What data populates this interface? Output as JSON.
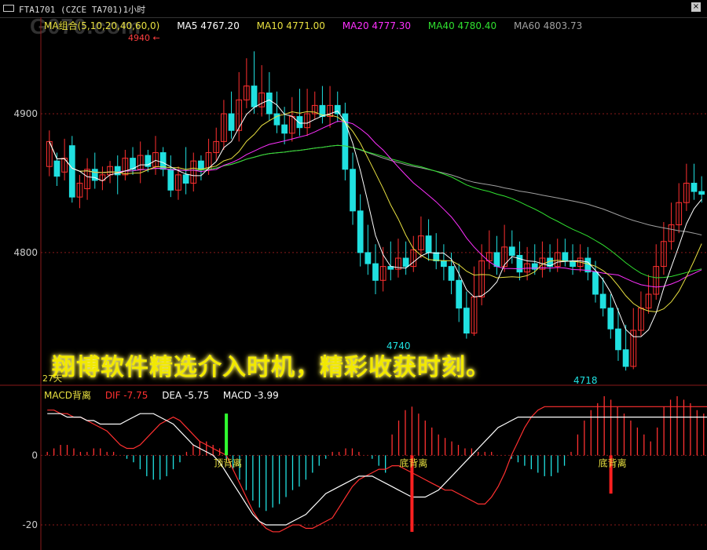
{
  "window": {
    "title": "FTA1701 (CZCE TA701)1小时",
    "close_glyph": "×"
  },
  "watermark": "G070.com",
  "ma_legend": [
    {
      "label": "MA组合(5,10,20,40,60,0)",
      "color": "#e8e040"
    },
    {
      "label": "MA5 4767.20",
      "color": "#ffffff"
    },
    {
      "label": "MA10 4771.00",
      "color": "#e8e040"
    },
    {
      "label": "MA20 4777.30",
      "color": "#ff30ff"
    },
    {
      "label": "MA40 4780.40",
      "color": "#30e030"
    },
    {
      "label": "MA60 4803.73",
      "color": "#a0a0a0"
    }
  ],
  "macd_legend": [
    {
      "label": "MACD背离",
      "color": "#e8e040"
    },
    {
      "label": "DIF  -7.75",
      "color": "#ff3030"
    },
    {
      "label": "DEA  -5.75",
      "color": "#ffffff"
    },
    {
      "label": "MACD  -3.99",
      "color": "#ffffff"
    }
  ],
  "banner": "翔博软件精选介入时机，精彩收获时刻。",
  "annotations": {
    "high_marker": "4940",
    "low1": "4740",
    "low2": "4718",
    "bottom_label": "27天"
  },
  "macd_annotations": [
    "顶背离",
    "底背离",
    "底背离"
  ],
  "colors": {
    "up": "#ff3030",
    "down": "#20e0e0",
    "grid": "#8a1a1a"
  },
  "chart_data": [
    {
      "type": "candlestick",
      "title": "",
      "y_ticks": [
        4800,
        4900
      ],
      "ylim": [
        4705,
        4965
      ],
      "candles": [
        [
          4862,
          4880,
          4866,
          4888,
          4855
        ],
        [
          4866,
          4855,
          4858,
          4872,
          4848
        ],
        [
          4858,
          4868,
          4877,
          4882,
          4852
        ],
        [
          4877,
          4840,
          4881,
          4884,
          4836
        ],
        [
          4840,
          4850,
          4846,
          4856,
          4832
        ],
        [
          4846,
          4860,
          4860,
          4868,
          4838
        ],
        [
          4860,
          4852,
          4866,
          4872,
          4846
        ],
        [
          4852,
          4856,
          4857,
          4862,
          4845
        ],
        [
          4856,
          4862,
          4856,
          4866,
          4850
        ],
        [
          4862,
          4856,
          4866,
          4870,
          4842
        ],
        [
          4856,
          4868,
          4870,
          4874,
          4852
        ],
        [
          4868,
          4860,
          4872,
          4876,
          4856
        ],
        [
          4860,
          4870,
          4872,
          4880,
          4850
        ],
        [
          4870,
          4862,
          4866,
          4874,
          4858
        ],
        [
          4862,
          4872,
          4880,
          4884,
          4856
        ],
        [
          4872,
          4860,
          4866,
          4876,
          4855
        ],
        [
          4860,
          4845,
          4866,
          4870,
          4840
        ],
        [
          4845,
          4856,
          4858,
          4862,
          4838
        ],
        [
          4856,
          4850,
          4872,
          4876,
          4842
        ],
        [
          4850,
          4866,
          4868,
          4872,
          4844
        ],
        [
          4866,
          4860,
          4868,
          4870,
          4852
        ],
        [
          4860,
          4872,
          4878,
          4882,
          4856
        ],
        [
          4872,
          4880,
          4884,
          4890,
          4866
        ],
        [
          4880,
          4900,
          4906,
          4910,
          4874
        ],
        [
          4900,
          4888,
          4910,
          4916,
          4882
        ],
        [
          4888,
          4910,
          4922,
          4930,
          4880
        ],
        [
          4910,
          4920,
          4925,
          4940,
          4904
        ],
        [
          4920,
          4905,
          4932,
          4945,
          4900
        ],
        [
          4905,
          4915,
          4925,
          4935,
          4898
        ],
        [
          4915,
          4900,
          4925,
          4930,
          4895
        ],
        [
          4900,
          4892,
          4910,
          4916,
          4886
        ],
        [
          4892,
          4886,
          4898,
          4905,
          4878
        ],
        [
          4886,
          4898,
          4905,
          4912,
          4880
        ],
        [
          4898,
          4890,
          4910,
          4918,
          4884
        ],
        [
          4890,
          4900,
          4910,
          4918,
          4884
        ],
        [
          4900,
          4906,
          4908,
          4916,
          4896
        ],
        [
          4906,
          4898,
          4914,
          4920,
          4893
        ],
        [
          4898,
          4906,
          4912,
          4920,
          4890
        ],
        [
          4906,
          4900,
          4912,
          4916,
          4894
        ],
        [
          4900,
          4860,
          4905,
          4908,
          4852
        ],
        [
          4860,
          4830,
          4866,
          4872,
          4820
        ],
        [
          4830,
          4800,
          4834,
          4842,
          4790
        ],
        [
          4800,
          4792,
          4812,
          4820,
          4784
        ],
        [
          4792,
          4780,
          4800,
          4806,
          4770
        ],
        [
          4780,
          4790,
          4797,
          4804,
          4772
        ],
        [
          4790,
          4788,
          4800,
          4808,
          4780
        ],
        [
          4788,
          4796,
          4802,
          4810,
          4782
        ],
        [
          4796,
          4790,
          4800,
          4808,
          4784
        ],
        [
          4790,
          4802,
          4806,
          4812,
          4786
        ],
        [
          4802,
          4812,
          4820,
          4826,
          4796
        ],
        [
          4812,
          4800,
          4818,
          4824,
          4794
        ],
        [
          4800,
          4794,
          4808,
          4814,
          4788
        ],
        [
          4794,
          4790,
          4800,
          4806,
          4780
        ],
        [
          4790,
          4780,
          4796,
          4800,
          4770
        ],
        [
          4780,
          4760,
          4788,
          4792,
          4750
        ],
        [
          4760,
          4742,
          4766,
          4772,
          4738
        ],
        [
          4742,
          4768,
          4776,
          4790,
          4740
        ],
        [
          4768,
          4794,
          4802,
          4806,
          4762
        ],
        [
          4794,
          4800,
          4808,
          4816,
          4788
        ],
        [
          4800,
          4790,
          4806,
          4812,
          4784
        ],
        [
          4790,
          4804,
          4812,
          4820,
          4786
        ],
        [
          4804,
          4798,
          4810,
          4816,
          4792
        ],
        [
          4798,
          4786,
          4802,
          4808,
          4780
        ],
        [
          4786,
          4792,
          4798,
          4804,
          4780
        ],
        [
          4792,
          4788,
          4800,
          4806,
          4784
        ],
        [
          4788,
          4796,
          4800,
          4808,
          4782
        ],
        [
          4796,
          4790,
          4800,
          4806,
          4786
        ],
        [
          4790,
          4800,
          4804,
          4810,
          4786
        ],
        [
          4800,
          4794,
          4806,
          4810,
          4790
        ],
        [
          4794,
          4790,
          4800,
          4806,
          4784
        ],
        [
          4790,
          4796,
          4800,
          4806,
          4786
        ],
        [
          4796,
          4786,
          4800,
          4804,
          4780
        ],
        [
          4786,
          4770,
          4790,
          4794,
          4764
        ],
        [
          4770,
          4760,
          4776,
          4782,
          4754
        ],
        [
          4760,
          4745,
          4765,
          4770,
          4738
        ],
        [
          4745,
          4730,
          4752,
          4760,
          4722
        ],
        [
          4730,
          4718,
          4740,
          4748,
          4715
        ],
        [
          4718,
          4744,
          4752,
          4760,
          4716
        ],
        [
          4744,
          4760,
          4766,
          4772,
          4740
        ],
        [
          4760,
          4770,
          4776,
          4784,
          4756
        ],
        [
          4770,
          4790,
          4796,
          4806,
          4766
        ],
        [
          4790,
          4808,
          4814,
          4822,
          4784
        ],
        [
          4808,
          4820,
          4826,
          4836,
          4802
        ],
        [
          4820,
          4836,
          4842,
          4850,
          4814
        ],
        [
          4836,
          4850,
          4856,
          4864,
          4830
        ],
        [
          4850,
          4844,
          4858,
          4864,
          4838
        ],
        [
          4844,
          4842,
          4848,
          4855,
          4836
        ]
      ]
    },
    {
      "type": "bar+line",
      "title": "",
      "y_ticks": [
        0,
        -20
      ],
      "ylim": [
        -27,
        17
      ],
      "macd": [
        1,
        2,
        3,
        3,
        2,
        1,
        1,
        2,
        2,
        1,
        1,
        0,
        -1,
        -2,
        -4,
        -6,
        -7,
        -7,
        -6,
        -4,
        -2,
        1,
        3,
        4,
        4,
        3,
        2,
        -1,
        -4,
        -7,
        -10,
        -13,
        -15,
        -16,
        -15,
        -14,
        -12,
        -10,
        -9,
        -7,
        -5,
        -3,
        -1,
        1,
        1,
        2,
        2,
        1,
        0,
        -1,
        -3,
        -5,
        6,
        10,
        13,
        14,
        12,
        10,
        8,
        6,
        5,
        4,
        3,
        2,
        2,
        1,
        1,
        1,
        0,
        0,
        -1,
        -2,
        -3,
        -4,
        -5,
        -6,
        -6,
        -5,
        -3,
        1,
        6,
        10,
        13,
        15,
        17,
        16,
        14,
        12,
        10,
        8,
        6,
        4,
        8,
        14,
        16,
        17,
        16,
        15,
        13,
        12
      ],
      "dif": [
        13,
        13,
        12,
        12,
        11,
        11,
        10,
        9,
        8,
        7,
        5,
        3,
        2,
        2,
        3,
        5,
        7,
        9,
        10,
        11,
        10,
        8,
        6,
        4,
        3,
        2,
        1,
        0,
        -4,
        -8,
        -12,
        -16,
        -19,
        -21,
        -22,
        -22,
        -21,
        -20,
        -20,
        -21,
        -21,
        -20,
        -19,
        -18,
        -15,
        -12,
        -9,
        -7,
        -6,
        -5,
        -4,
        -4,
        -3,
        -3,
        -4,
        -5,
        -6,
        -7,
        -8,
        -9,
        -10,
        -10,
        -11,
        -12,
        -13,
        -14,
        -14,
        -12,
        -9,
        -5,
        0,
        4,
        8,
        11,
        13,
        14,
        14,
        14,
        14,
        14,
        14,
        14,
        14,
        14,
        14,
        14,
        14,
        14,
        14,
        14,
        14,
        14,
        14,
        14,
        14,
        14,
        14,
        14,
        14,
        14,
        14,
        14
      ],
      "dea": [
        12,
        12,
        12,
        11,
        11,
        11,
        10,
        10,
        9,
        9,
        9,
        9,
        10,
        11,
        12,
        12,
        12,
        11,
        10,
        9,
        7,
        5,
        3,
        2,
        1,
        0,
        -2,
        -5,
        -8,
        -11,
        -14,
        -17,
        -19,
        -20,
        -20,
        -20,
        -20,
        -19,
        -18,
        -17,
        -15,
        -13,
        -11,
        -10,
        -9,
        -8,
        -7,
        -6,
        -6,
        -6,
        -7,
        -8,
        -9,
        -10,
        -11,
        -12,
        -12,
        -12,
        -11,
        -10,
        -8,
        -6,
        -4,
        -2,
        0,
        2,
        4,
        6,
        8,
        9,
        10,
        11,
        11,
        11,
        11,
        11,
        11,
        11,
        11,
        11,
        11,
        11,
        11,
        11,
        11,
        11,
        11,
        11,
        11,
        11,
        11,
        11,
        11,
        11,
        11,
        11,
        11,
        11,
        11,
        11,
        11,
        11
      ]
    }
  ]
}
